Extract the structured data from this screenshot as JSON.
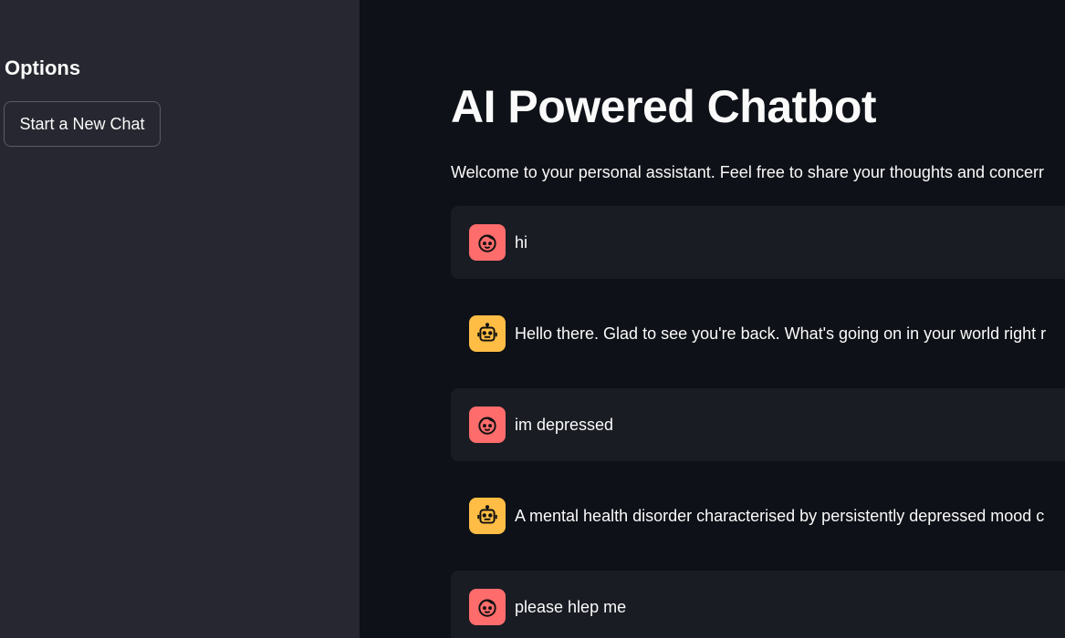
{
  "sidebar": {
    "title": "Options",
    "new_chat_label": "Start a New Chat"
  },
  "main": {
    "title": "AI Powered Chatbot",
    "welcome": "Welcome to your personal assistant. Feel free to share your thoughts and concerr"
  },
  "messages": [
    {
      "role": "user",
      "avatar_icon": "face-icon",
      "text": "hi"
    },
    {
      "role": "assistant",
      "avatar_icon": "robot-icon",
      "text": "Hello there. Glad to see you're back. What's going on in your world right r"
    },
    {
      "role": "user",
      "avatar_icon": "face-icon",
      "text": "im depressed"
    },
    {
      "role": "assistant",
      "avatar_icon": "robot-icon",
      "text": "A mental health disorder characterised by persistently depressed mood c"
    },
    {
      "role": "user",
      "avatar_icon": "face-icon",
      "text": "please hlep me"
    }
  ],
  "colors": {
    "background": "#0e1117",
    "sidebar": "#262730",
    "user_bubble": "#1a1c24",
    "user_avatar": "#ff6c6c",
    "assistant_avatar": "#ffbd45"
  }
}
